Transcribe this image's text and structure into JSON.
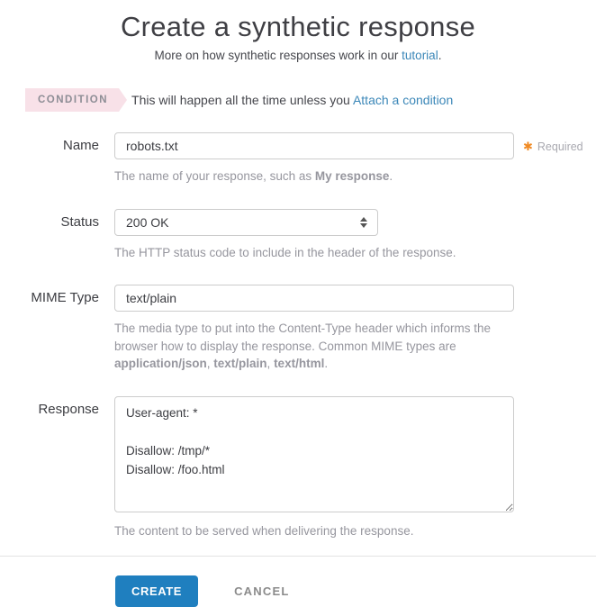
{
  "page": {
    "title": "Create a synthetic response",
    "subtitle_prefix": "More on how synthetic responses work in our ",
    "subtitle_link": "tutorial",
    "subtitle_suffix": "."
  },
  "condition": {
    "badge": "CONDITION",
    "text": "This will happen all the time unless you ",
    "link": "Attach a condition"
  },
  "fields": {
    "name": {
      "label": "Name",
      "value": "robots.txt",
      "required_asterisk": "✱",
      "required_label": "Required",
      "help_prefix": "The name of your response, such as ",
      "help_bold": "My response",
      "help_suffix": "."
    },
    "status": {
      "label": "Status",
      "value": "200 OK",
      "help": "The HTTP status code to include in the header of the response."
    },
    "mime": {
      "label": "MIME Type",
      "value": "text/plain",
      "help_prefix": "The media type to put into the Content-Type header which informs the browser how to display the response. Common MIME types are ",
      "help_bold1": "application/json",
      "help_sep1": ", ",
      "help_bold2": "text/plain",
      "help_sep2": ", ",
      "help_bold3": "text/html",
      "help_suffix": "."
    },
    "response": {
      "label": "Response",
      "value": "User-agent: *\n\nDisallow: /tmp/*\nDisallow: /foo.html",
      "help": "The content to be served when delivering the response."
    }
  },
  "actions": {
    "create": "CREATE",
    "cancel": "CANCEL"
  },
  "colors": {
    "accent_blue": "#1f7fbf",
    "link_blue": "#3b87b8",
    "badge_pink": "#f8e1e8",
    "required_orange": "#f08a24"
  }
}
